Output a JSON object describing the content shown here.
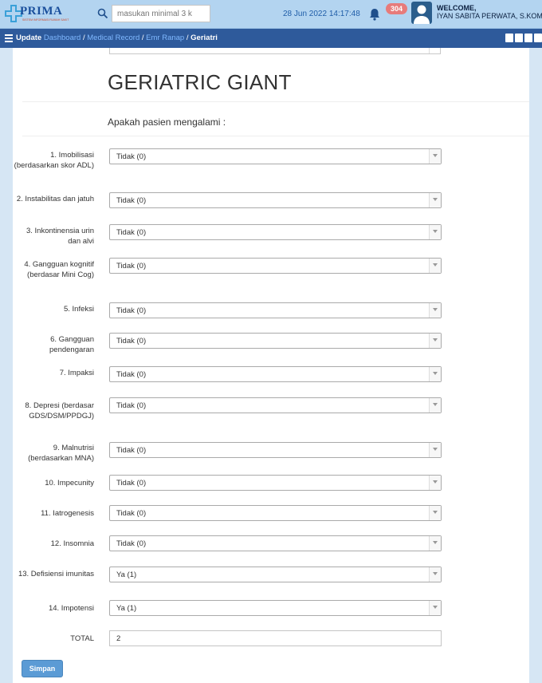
{
  "header": {
    "logo_text": "PRIMA",
    "logo_subtext": "SISTEM INFORMASI RUMAH SAKIT",
    "search_placeholder": "masukan minimal 3 k",
    "datetime": "28 Jun 2022 14:17:48",
    "notification_count": "304",
    "welcome_label": "WELCOME,",
    "user_name": "IYAN SABITA PERWATA, S.KOM"
  },
  "breadcrumb": {
    "prefix": "Update",
    "items": [
      "Dashboard",
      "Medical Record",
      "Emr Ranap"
    ],
    "current": "Geriatri",
    "separator": "/"
  },
  "form": {
    "title": "GERIATRIC GIANT",
    "question": "Apakah pasien mengalami :",
    "items": [
      {
        "label": "1. Imobilisasi (berdasarkan skor ADL)",
        "value": "Tidak (0)"
      },
      {
        "label": "2. Instabilitas dan jatuh",
        "value": "Tidak (0)"
      },
      {
        "label": "3. Inkontinensia urin dan alvi",
        "value": "Tidak (0)"
      },
      {
        "label": "4. Gangguan kognitif (berdasar Mini Cog)",
        "value": "Tidak (0)"
      },
      {
        "label": "5. Infeksi",
        "value": "Tidak (0)"
      },
      {
        "label": "6. Gangguan pendengaran",
        "value": "Tidak (0)"
      },
      {
        "label": "7. Impaksi",
        "value": "Tidak (0)"
      },
      {
        "label": "8. Depresi (berdasar GDS/DSM/PPDGJ)",
        "value": "Tidak (0)"
      },
      {
        "label": "9. Malnutrisi (berdasarkan MNA)",
        "value": "Tidak (0)"
      },
      {
        "label": "10. Impecunity",
        "value": "Tidak (0)"
      },
      {
        "label": "11. Iatrogenesis",
        "value": "Tidak (0)"
      },
      {
        "label": "12. Insomnia",
        "value": "Tidak (0)"
      },
      {
        "label": "13. Defisiensi imunitas",
        "value": "Ya (1)"
      },
      {
        "label": "14. Impotensi",
        "value": "Ya (1)"
      }
    ],
    "total_label": "TOTAL",
    "total_value": "2",
    "submit_label": "Simpan"
  },
  "colors": {
    "topbar": "#b3d4f0",
    "navbar": "#2e5a9b",
    "button": "#5b9bd5",
    "badge": "#e77b7b"
  }
}
